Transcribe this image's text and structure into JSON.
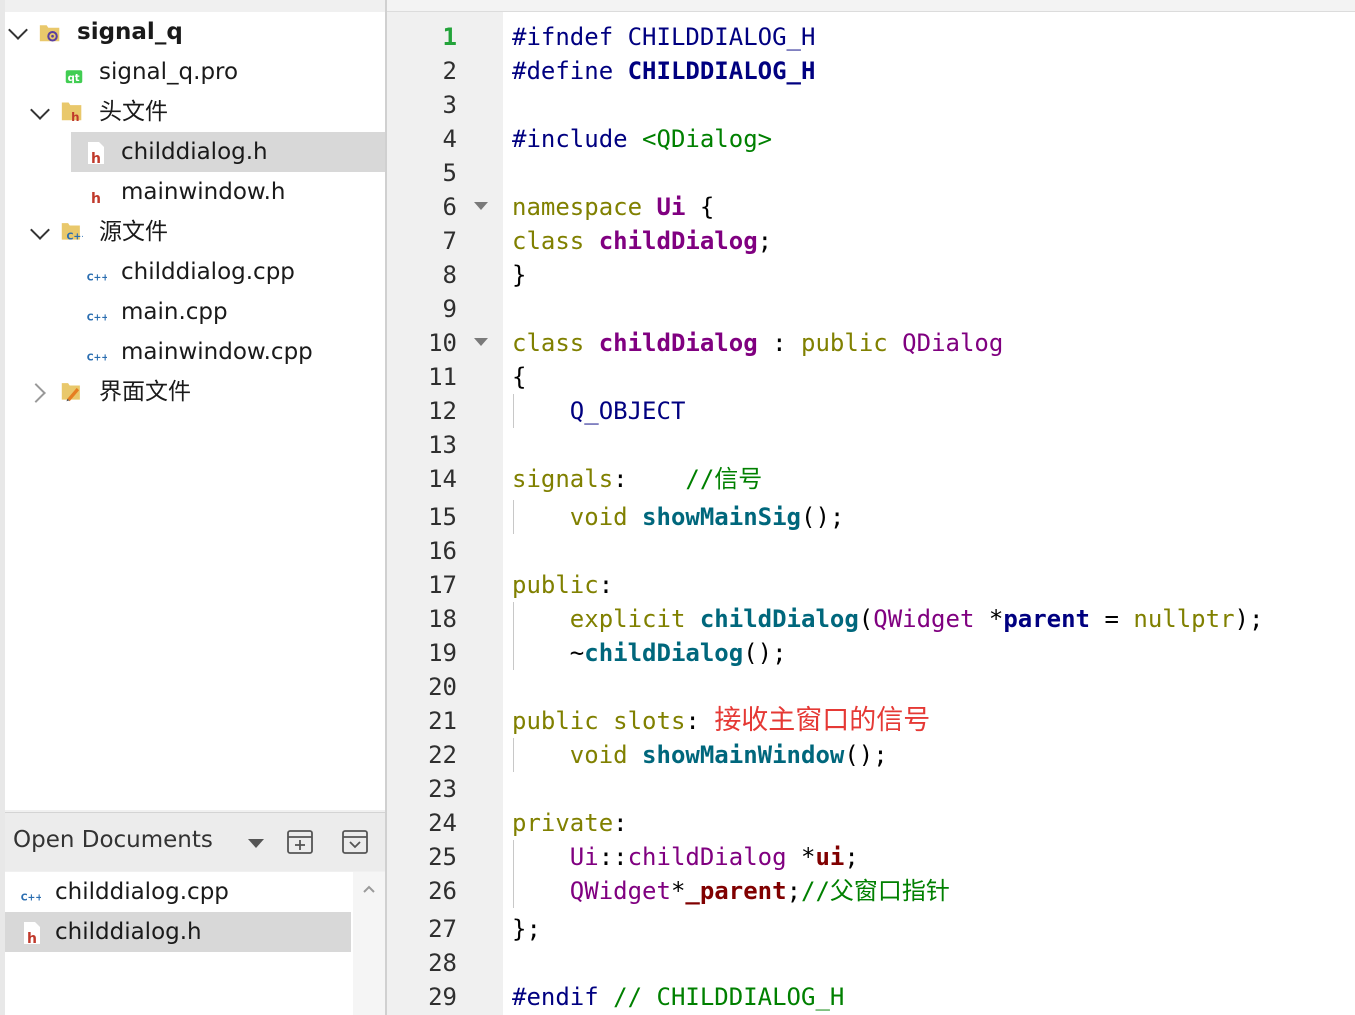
{
  "project_tree": {
    "project_name": "signal_q",
    "items": [
      {
        "label": "signal_q.pro"
      },
      {
        "label": "头文件"
      },
      {
        "label": "childdialog.h"
      },
      {
        "label": "mainwindow.h"
      },
      {
        "label": "源文件"
      },
      {
        "label": "childdialog.cpp"
      },
      {
        "label": "main.cpp"
      },
      {
        "label": "mainwindow.cpp"
      },
      {
        "label": "界面文件"
      }
    ]
  },
  "open_documents": {
    "title": "Open Documents",
    "items": [
      {
        "label": "childdialog.cpp"
      },
      {
        "label": "childdialog.h"
      }
    ]
  },
  "editor": {
    "file": "childdialog.h",
    "current_line": 1,
    "line_numbers": [
      "1",
      "2",
      "3",
      "4",
      "5",
      "6",
      "7",
      "8",
      "9",
      "10",
      "11",
      "12",
      "13",
      "14",
      "15",
      "16",
      "17",
      "18",
      "19",
      "20",
      "21",
      "22",
      "23",
      "24",
      "25",
      "26",
      "27",
      "28",
      "29"
    ],
    "code": {
      "l1a": "#ifndef",
      "l1b": "CHILDDIALOG_H",
      "l2a": "#define",
      "l2b": "CHILDDIALOG_H",
      "l4a": "#include",
      "l4b": "<QDialog>",
      "l6a": "namespace",
      "l6b": "Ui",
      "l6c": "{",
      "l7a": "class",
      "l7b": "childDialog",
      "l7c": ";",
      "l8": "}",
      "l10a": "class",
      "l10b": "childDialog",
      "l10c": ":",
      "l10d": "public",
      "l10e": "QDialog",
      "l11": "{",
      "l12": "Q_OBJECT",
      "l14a": "signals",
      "l14b": ":",
      "l14c": "//信号",
      "l15a": "void",
      "l15b": "showMainSig",
      "l15c": "();",
      "l17a": "public",
      "l17b": ":",
      "l18a": "explicit",
      "l18b": "childDialog",
      "l18c": "(",
      "l18d": "QWidget",
      "l18e": "*",
      "l18f": "parent",
      "l18g": "=",
      "l18h": "nullptr",
      "l18i": ");",
      "l19a": "~",
      "l19b": "childDialog",
      "l19c": "();",
      "l21a": "public",
      "l21b": "slots",
      "l21c": ":",
      "l21_annotation": "接收主窗口的信号",
      "l22a": "void",
      "l22b": "showMainWindow",
      "l22c": "();",
      "l24a": "private",
      "l24b": ":",
      "l25a": "Ui",
      "l25b": "::",
      "l25c": "childDialog",
      "l25d": "*",
      "l25e": "ui",
      "l25f": ";",
      "l26a": "QWidget",
      "l26b": "*",
      "l26c": "_parent",
      "l26d": ";",
      "l26e": "//父窗口指针",
      "l27": "};",
      "l29a": "#endif",
      "l29b": "// CHILDDIALOG_H"
    }
  },
  "colors": {
    "keyword": "#808000",
    "type": "#800080",
    "function": "#00677c",
    "preprocessor": "#000080",
    "comment": "#008000",
    "member": "#800000",
    "annotation": "#e53935",
    "current_line_number": "#23a33a",
    "selection": "#d8d8d8"
  },
  "icons": [
    "chevron-down-icon",
    "chevron-right-icon",
    "project-icon",
    "qt-pro-file-icon",
    "header-folder-icon",
    "header-file-icon",
    "source-folder-icon",
    "cpp-file-icon",
    "forms-folder-icon",
    "split-icon",
    "collapse-icon",
    "scroll-up-icon",
    "fold-marker-icon"
  ]
}
